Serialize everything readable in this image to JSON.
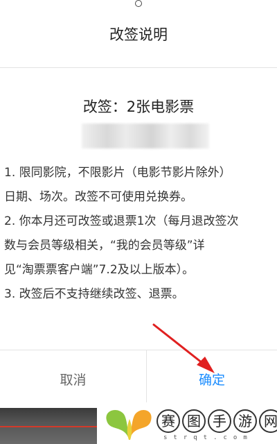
{
  "dialog": {
    "title": "改签说明",
    "subtitle": "改签：2张电影票",
    "notes": [
      "1. 限同影院，不限影片（电影节影片除外）",
      "    日期、场次。改签不可使用兑换券。",
      "2. 你本月还可改签或退票1次（每月退改签次",
      "    数与会员等级相关，“我的会员等级”详",
      "    见“淘票票客户端”7.2及以上版本）。",
      "3. 改签后不支持继续改签、退票。"
    ],
    "cancel_label": "取消",
    "confirm_label": "确定"
  },
  "watermark": {
    "chars": [
      "赛",
      "图",
      "手",
      "游",
      "网"
    ],
    "url": "strqt.com"
  },
  "colors": {
    "confirm": "#1a8cff",
    "arrow": "#e02020",
    "divider": "#e3e3e3"
  }
}
